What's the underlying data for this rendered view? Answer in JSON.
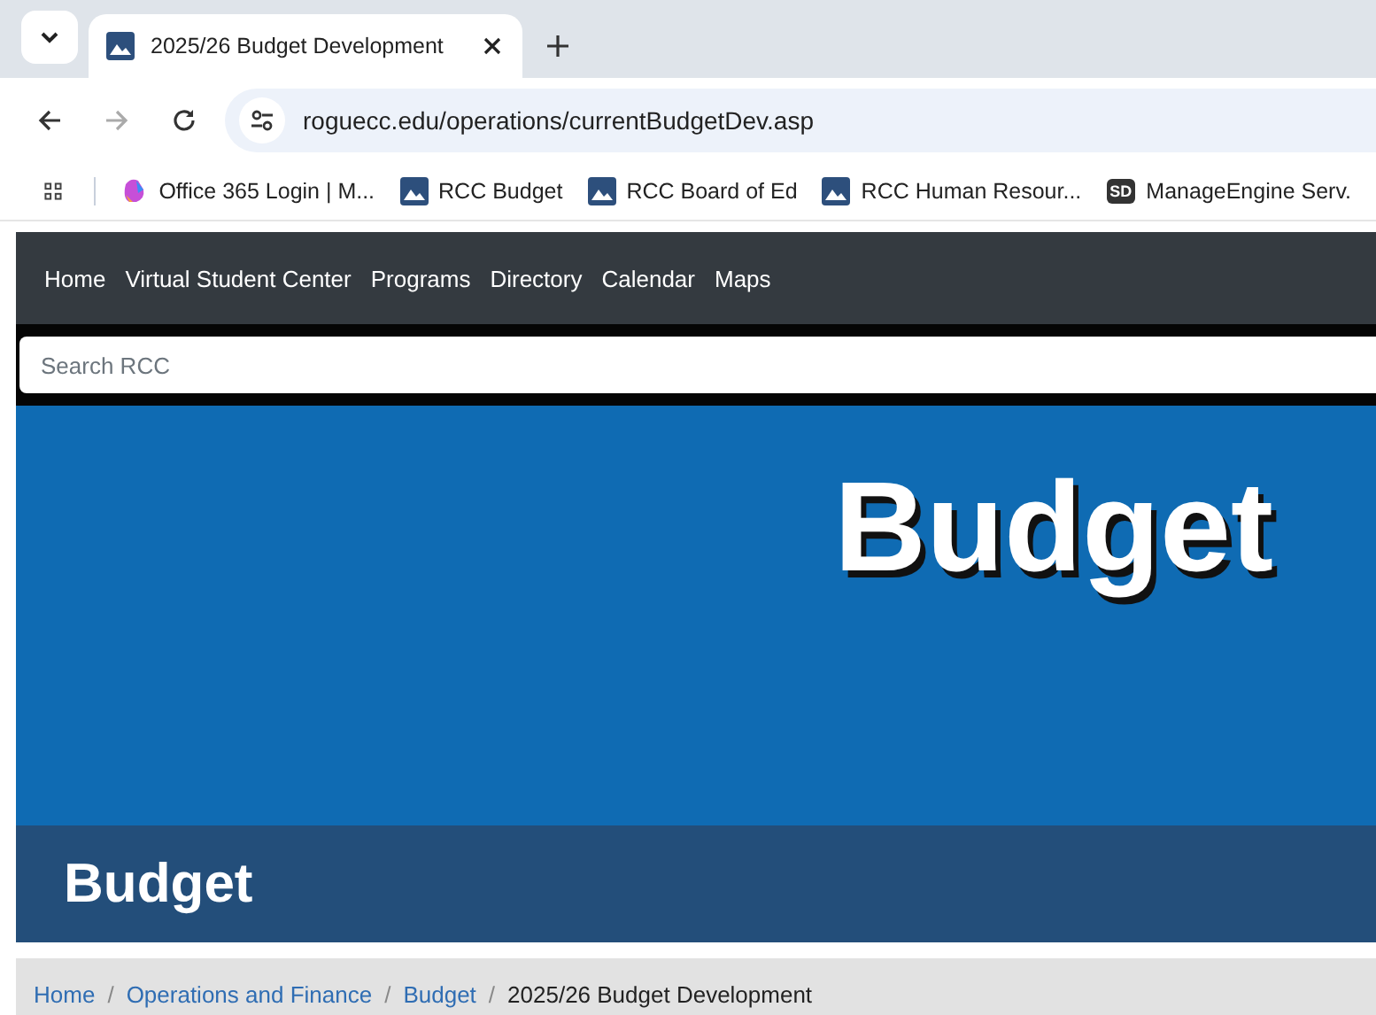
{
  "browser": {
    "tab": {
      "title": "2025/26 Budget Development",
      "selected": true
    },
    "url": "roguecc.edu/operations/currentBudgetDev.asp",
    "bookmarks": [
      {
        "kind": "copilot",
        "label": "Office 365 Login | M..."
      },
      {
        "kind": "image",
        "label": "RCC Budget"
      },
      {
        "kind": "image",
        "label": "RCC Board of Ed"
      },
      {
        "kind": "image",
        "label": "RCC Human Resour..."
      },
      {
        "kind": "badge",
        "badge": "SD",
        "label": "ManageEngine Serv."
      }
    ]
  },
  "nav": {
    "items": [
      "Home",
      "Virtual Student Center",
      "Programs",
      "Directory",
      "Calendar",
      "Maps"
    ]
  },
  "search": {
    "placeholder": "Search RCC"
  },
  "hero": {
    "title": "Budget"
  },
  "banner": {
    "title": "Budget"
  },
  "breadcrumb": {
    "separator": "/",
    "items": [
      {
        "label": "Home",
        "current": false
      },
      {
        "label": "Operations and Finance",
        "current": false
      },
      {
        "label": "Budget",
        "current": false
      },
      {
        "label": "2025/26 Budget Development",
        "current": true
      }
    ]
  }
}
